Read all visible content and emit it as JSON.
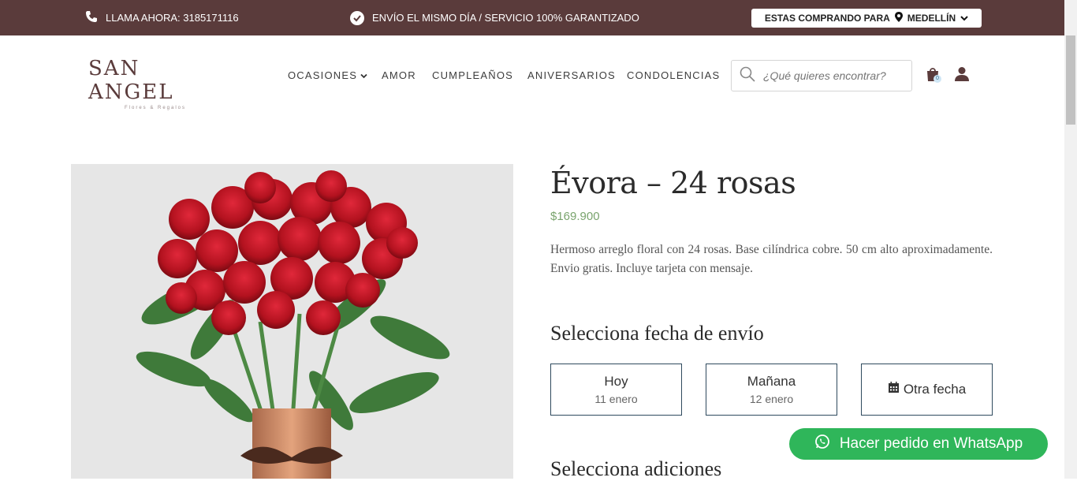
{
  "topbar": {
    "call_text": "LLAMA AHORA: 3185171116",
    "shipping_text": "ENVÍO EL MISMO DÍA / SERVICIO 100% GARANTIZADO",
    "buying_for_label": "ESTAS COMPRANDO PARA",
    "city": "MEDELLÍN",
    "bg_color": "#5a3b3b"
  },
  "header": {
    "logo_text": "SAN ANGEL",
    "logo_subtext": "Flores & Regalos",
    "nav": [
      {
        "label": "OCASIONES"
      },
      {
        "label": "AMOR"
      },
      {
        "label": "CUMPLEAÑOS"
      },
      {
        "label": "ANIVERSARIOS"
      },
      {
        "label": "CONDOLENCIAS"
      }
    ],
    "search_placeholder": "¿Qué quieres encontrar?",
    "cart_count": "0"
  },
  "product": {
    "title": "Évora – 24 rosas",
    "price": "$169.900",
    "description": "Hermoso arreglo floral con 24 rosas. Base cilíndrica cobre. 50 cm alto aproximadamente. Envio gratis. Incluye tarjeta con mensaje.",
    "date_heading": "Selecciona fecha de envío",
    "date_options": [
      {
        "label": "Hoy",
        "date": "11 enero"
      },
      {
        "label": "Mañana",
        "date": "12 enero"
      },
      {
        "label": "Otra fecha"
      }
    ],
    "additions_heading": "Selecciona adiciones"
  },
  "whatsapp": {
    "label": "Hacer pedido en WhatsApp",
    "color": "#2fb65a"
  },
  "colors": {
    "accent": "#5a3b3b",
    "price": "#7aa46e",
    "button_border": "#2f4a5e"
  }
}
